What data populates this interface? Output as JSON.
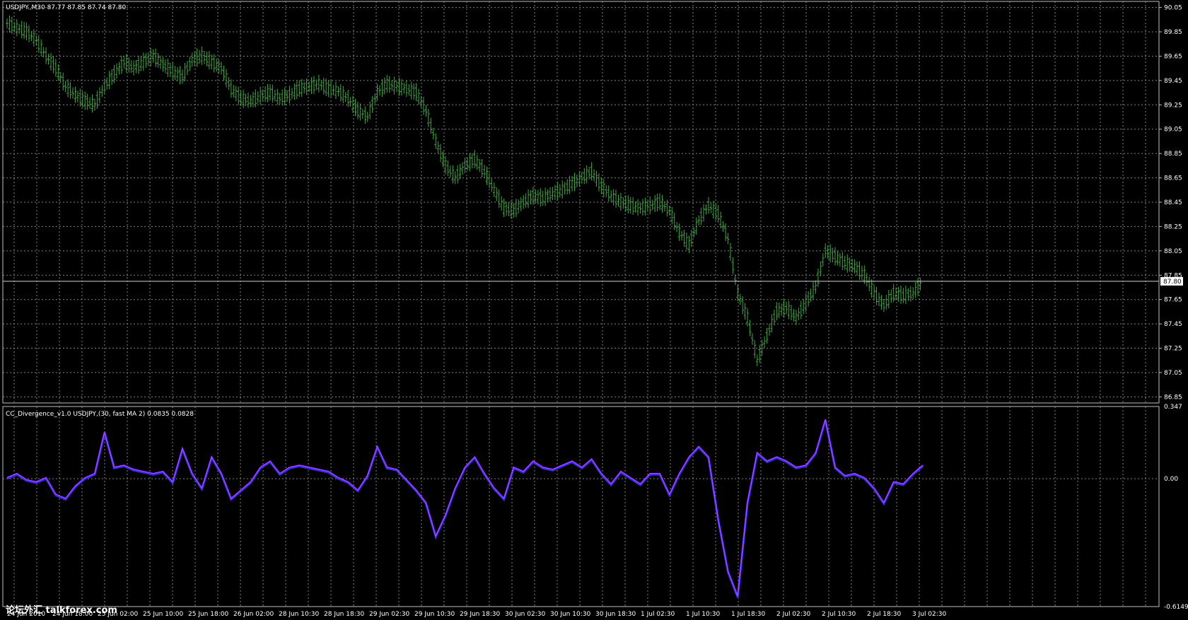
{
  "window": {
    "main_title": "USDJPY.,M30  87.77 87.85 87.74 87.80",
    "indicator_title": "CC_Divergence_v1.0 USDJPY,(30, fast MA 2) 0.0835 0.0828",
    "current_price_label": "87.80",
    "watermark": "论坛外汇 talkforex.com"
  },
  "colors": {
    "background": "#000000",
    "grid": "#7f7f7f",
    "bars": "#3fa63f",
    "indicator_slow": "#2a2aff",
    "indicator_fast": "#b040ff",
    "divergence_bear": "#ff2020",
    "divergence_bull": "#20a020"
  },
  "chart_data": [
    {
      "type": "line",
      "series": [
        {
          "values": [
            89.92,
            89.88,
            89.85,
            89.78,
            89.65,
            89.55,
            89.4,
            89.33,
            89.28,
            89.25,
            89.4,
            89.5,
            89.6,
            89.55,
            89.6,
            89.65,
            89.58,
            89.52,
            89.48,
            89.62,
            89.65,
            89.6,
            89.55,
            89.38,
            89.3,
            89.28,
            89.32,
            89.35,
            89.3,
            89.33,
            89.38,
            89.4,
            89.42,
            89.38,
            89.36,
            89.3,
            89.2,
            89.15,
            89.35,
            89.42,
            89.4,
            89.38,
            89.35,
            89.2,
            88.95,
            88.75,
            88.65,
            88.75,
            88.8,
            88.7,
            88.55,
            88.4,
            88.38,
            88.45,
            88.5,
            88.48,
            88.52,
            88.55,
            88.6,
            88.65,
            88.7,
            88.58,
            88.5,
            88.45,
            88.42,
            88.4,
            88.42,
            88.45,
            88.38,
            88.2,
            88.1,
            88.3,
            88.42,
            88.35,
            88.15,
            87.7,
            87.5,
            87.15,
            87.35,
            87.55,
            87.58,
            87.5,
            87.62,
            87.75,
            88.05,
            88.0,
            87.95,
            87.92,
            87.85,
            87.7,
            87.6,
            87.7,
            87.68,
            87.7,
            87.8
          ]
        }
      ],
      "x_tick_labels": [
        "24 Jun 2010",
        "24 Jun 18:00",
        "25 Jun 02:00",
        "25 Jun 10:00",
        "25 Jun 18:00",
        "26 Jun 02:00",
        "28 Jun 10:30",
        "28 Jun 18:30",
        "29 Jun 02:30",
        "29 Jun 10:30",
        "29 Jun 18:30",
        "30 Jun 02:30",
        "30 Jun 10:30",
        "30 Jun 18:30",
        "1 Jul 02:30",
        "1 Jul 10:30",
        "1 Jul 18:30",
        "2 Jul 02:30",
        "2 Jul 10:30",
        "2 Jul 18:30",
        "3 Jul 02:30"
      ],
      "y_tick_labels": [
        "90.05",
        "89.85",
        "89.65",
        "89.45",
        "89.25",
        "89.05",
        "88.85",
        "88.65",
        "88.45",
        "88.25",
        "88.05",
        "87.85",
        "87.65",
        "87.45",
        "87.25",
        "87.05",
        "86.85"
      ],
      "ylim": [
        86.8,
        90.1
      ],
      "grid": true
    },
    {
      "type": "line",
      "series": [
        {
          "values": [
            0.0,
            0.02,
            -0.01,
            -0.02,
            0.0,
            -0.08,
            -0.1,
            -0.04,
            0.0,
            0.02,
            0.22,
            0.05,
            0.06,
            0.04,
            0.03,
            0.02,
            0.03,
            -0.02,
            0.14,
            0.02,
            -0.05,
            0.1,
            0.02,
            -0.1,
            -0.06,
            -0.02,
            0.05,
            0.08,
            0.02,
            0.05,
            0.06,
            0.05,
            0.04,
            0.03,
            0.0,
            -0.02,
            -0.06,
            0.01,
            0.15,
            0.05,
            0.04,
            -0.01,
            -0.06,
            -0.12,
            -0.28,
            -0.18,
            -0.05,
            0.05,
            0.1,
            0.02,
            -0.05,
            -0.1,
            0.05,
            0.03,
            0.08,
            0.05,
            0.04,
            0.06,
            0.08,
            0.05,
            0.09,
            0.02,
            -0.03,
            0.03,
            0.0,
            -0.03,
            0.02,
            0.02,
            -0.08,
            0.02,
            0.1,
            0.15,
            0.1,
            -0.2,
            -0.45,
            -0.57,
            -0.12,
            0.12,
            0.08,
            0.1,
            0.08,
            0.05,
            0.06,
            0.12,
            0.28,
            0.05,
            0.01,
            0.02,
            0.0,
            -0.05,
            -0.12,
            -0.02,
            -0.03,
            0.02,
            0.06
          ]
        }
      ],
      "y_tick_labels": [
        "0.347",
        "0.00",
        "-0.6149"
      ],
      "ylim": [
        -0.6149,
        0.347
      ],
      "grid": true
    }
  ]
}
